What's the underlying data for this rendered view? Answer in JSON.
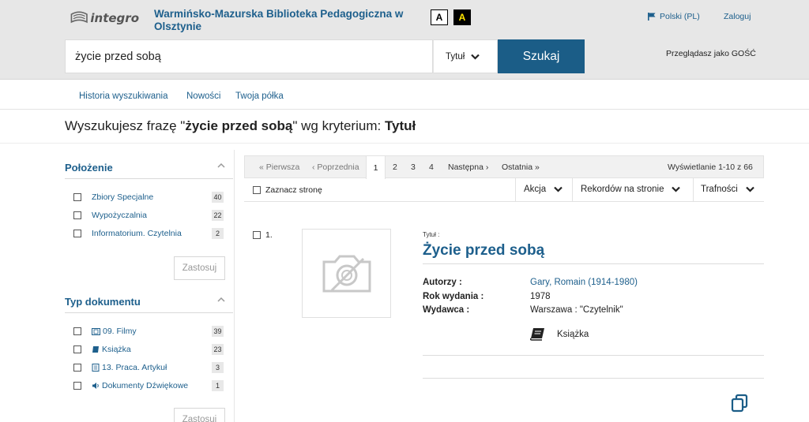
{
  "header": {
    "logo_text": "integro",
    "library_name": "Warmińsko-Mazurska Biblioteka Pedagogiczna w Olsztynie",
    "contrast_a": "A",
    "contrast_b": "A",
    "language": "Polski (PL)",
    "login": "Zaloguj",
    "guest_text": "Przeglądasz jako GOŚĆ"
  },
  "search": {
    "query": "życie przed sobą",
    "criterion": "Tytuł",
    "button": "Szukaj"
  },
  "nav": {
    "items": [
      "Historia wyszukiwania",
      "Nowości",
      "Twoja półka"
    ]
  },
  "query_title": {
    "prefix": "Wyszukujesz frazę \"",
    "phrase": "życie przed sobą",
    "middle": "\" wg kryterium: ",
    "criterion": "Tytuł"
  },
  "sidebar": {
    "location": {
      "title": "Położenie",
      "items": [
        {
          "label": "Zbiory Specjalne",
          "count": "40"
        },
        {
          "label": "Wypożyczalnia",
          "count": "22"
        },
        {
          "label": "Informatorium. Czytelnia",
          "count": "2"
        }
      ],
      "apply": "Zastosuj"
    },
    "doc_type": {
      "title": "Typ dokumentu",
      "items": [
        {
          "label": "09. Filmy",
          "count": "39",
          "icon": "film-icon"
        },
        {
          "label": "Książka",
          "count": "23",
          "icon": "book-icon"
        },
        {
          "label": "13. Praca. Artykuł",
          "count": "3",
          "icon": "article-icon"
        },
        {
          "label": "Dokumenty Dźwiękowe",
          "count": "1",
          "icon": "audio-icon"
        }
      ],
      "apply": "Zastosuj"
    }
  },
  "pager": {
    "first": "« Pierwsza",
    "prev": "‹ Poprzednia",
    "pages": [
      "1",
      "2",
      "3",
      "4"
    ],
    "current": "1",
    "next": "Następna ›",
    "last": "Ostatnia »",
    "display": "Wyświetlanie 1-10 z 66"
  },
  "toolbar": {
    "mark_page": "Zaznacz stronę",
    "action": "Akcja",
    "per_page": "Rekordów na stronie",
    "sort": "Trafności"
  },
  "record": {
    "number": "1.",
    "title_label": "Tytuł :",
    "title": "Życie przed sobą",
    "authors_label": "Autorzy :",
    "authors": "Gary, Romain (1914-1980)",
    "year_label": "Rok wydania :",
    "year": "1978",
    "publisher_label": "Wydawca :",
    "publisher": "Warszawa : \"Czytelnik\"",
    "type": "Książka"
  },
  "colors": {
    "accent": "#1b5d87",
    "link": "#1d5f8c",
    "header_bg": "#e7e7e7"
  }
}
